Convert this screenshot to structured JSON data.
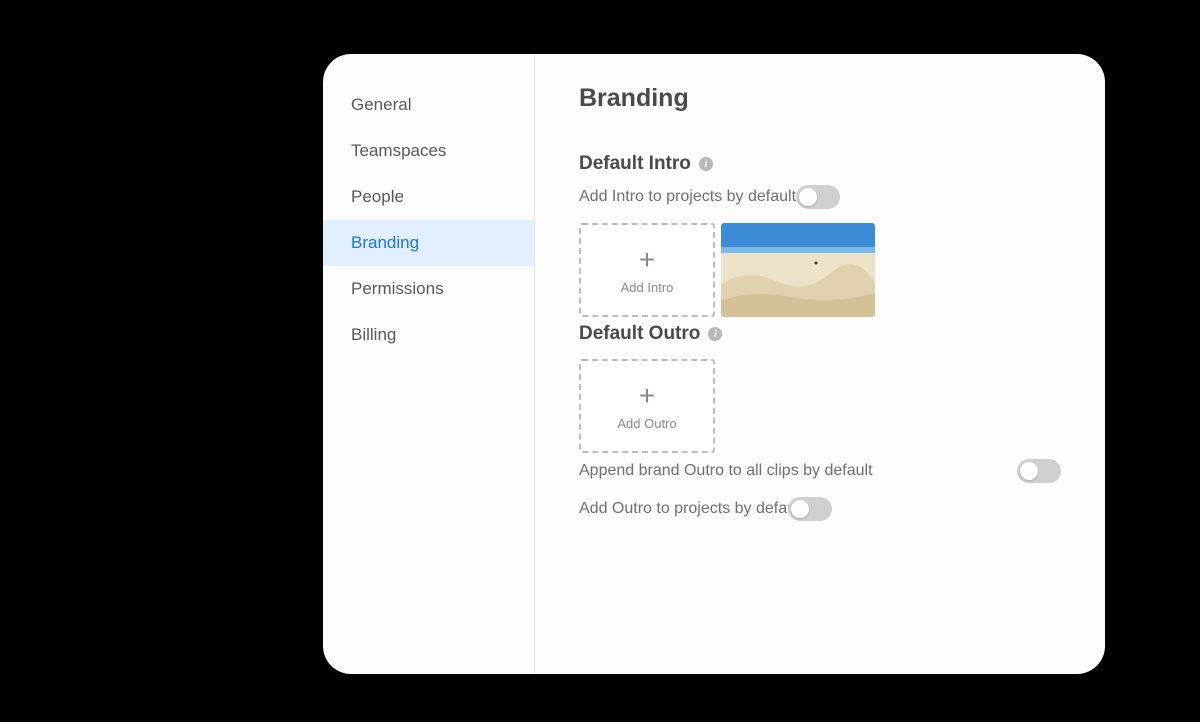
{
  "sidebar": {
    "items": [
      {
        "label": "General"
      },
      {
        "label": "Teamspaces"
      },
      {
        "label": "People"
      },
      {
        "label": "Branding"
      },
      {
        "label": "Permissions"
      },
      {
        "label": "Billing"
      }
    ],
    "active_index": 3
  },
  "page": {
    "title": "Branding",
    "sections": {
      "intro": {
        "heading": "Default Intro",
        "toggle_label": "Add Intro to projects by default",
        "add_tile_label": "Add Intro",
        "has_thumbnail": true
      },
      "outro": {
        "heading": "Default Outro",
        "add_tile_label": "Add Outro",
        "append_label": "Append brand Outro to all clips by default",
        "toggle_label": "Add Outro to projects by default"
      }
    }
  }
}
